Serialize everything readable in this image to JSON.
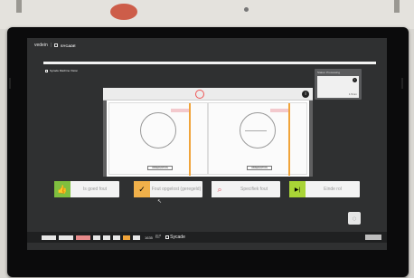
{
  "brand": {
    "name": "vedein",
    "sub": "SYCADE"
  },
  "video_title": "Sycade Machine Vision",
  "status_card": {
    "title": "Status: Processing",
    "value": "1.5mm",
    "badge": "i"
  },
  "camera": {
    "badge": "i",
    "left_label": "OBSERVATION",
    "right_label": "OBSERVATION"
  },
  "actions": [
    {
      "label": "Is goed fout",
      "icon": "thumbs-up-icon",
      "glyph": "👍",
      "color": "#7fbf3f"
    },
    {
      "label": "Fout opgelost (geregeld)",
      "icon": "check-icon",
      "glyph": "✓",
      "color": "#f0b04a"
    },
    {
      "label": "Specifiek fout",
      "icon": "search-icon",
      "glyph": "⌕",
      "color": "#e35d6a"
    },
    {
      "label": "Einde rol",
      "icon": "skip-end-icon",
      "glyph": "▶|",
      "color": "#a9d436"
    }
  ],
  "taskbar": {
    "number": "1635",
    "date_top": "09:45",
    "date_bottom": "5/11",
    "brand": "Sycade"
  },
  "fab": {
    "glyph": "◌"
  },
  "colors": {
    "accent_green": "#7fbf3f",
    "accent_orange": "#f0a43a",
    "accent_red": "#e35d6a"
  }
}
